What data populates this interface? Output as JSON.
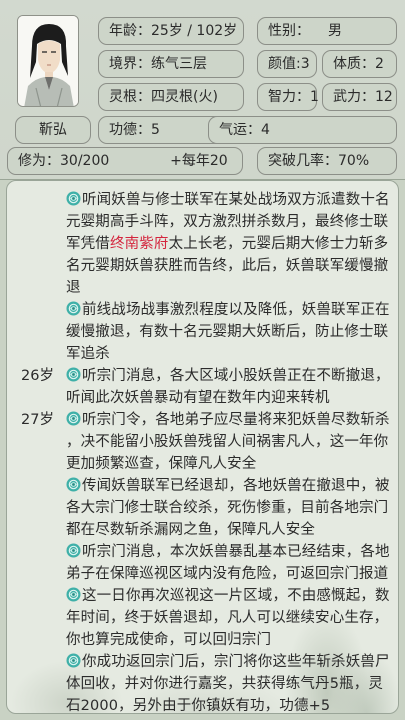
{
  "character": {
    "name": "靳弘",
    "age": "年龄：25岁 / 102岁",
    "gender_label": "性别：",
    "gender": "男",
    "realm": "境界：练气三层",
    "looks": "颜值:3",
    "physique": "体质：2",
    "spirit_root": "灵根：四灵根(火)",
    "intelligence": "智力：1",
    "force": "武力：12",
    "merit": "功德：5",
    "luck": "气运：4",
    "cultivation": "修为：30/200",
    "per_year": "+每年20",
    "breakthrough": "突破几率：70%"
  },
  "log": {
    "year_labels": [
      "26岁",
      "27岁"
    ],
    "entries": [
      {
        "lines": [
          "听闻妖兽与修士联军在某处战场双方派遣数十名",
          "元婴期高手斗阵，双方激烈拼杀数月，最终修士联"
        ],
        "line3_pre": "军凭借",
        "line3_highlight": "终南紫府",
        "line3_post": "太上长老，元婴后期大修士力斩多",
        "line4": "名元婴期妖兽获胜而告终，此后，妖兽联军缓慢撤",
        "line5": "退"
      },
      {
        "lines": [
          "前线战场战事激烈程度以及降低，妖兽联军正在",
          "缓慢撤退，有数十名元婴期大妖断后，防止修士联",
          "军追杀"
        ]
      },
      {
        "lines": [
          "听宗门消息，各大区域小股妖兽正在不断撤退，",
          "听闻此次妖兽暴动有望在数年内迎来转机"
        ]
      },
      {
        "lines": [
          "听宗门令，各地弟子应尽量将来犯妖兽尽数斩杀",
          "，决不能留小股妖兽残留人间祸害凡人，这一年你",
          "更加频繁巡查，保障凡人安全"
        ]
      },
      {
        "lines": [
          "传闻妖兽联军已经退却，各地妖兽在撤退中，被",
          "各大宗门修士联合绞杀，死伤惨重，目前各地宗门",
          "都在尽数斩杀漏网之鱼，保障凡人安全"
        ]
      },
      {
        "lines": [
          "听宗门消息，本次妖兽暴乱基本已经结束，各地",
          "弟子在保障巡视区域内没有危险，可返回宗门报道"
        ]
      },
      {
        "lines": [
          "这一日你再次巡视这一片区域，不由感慨起，数",
          "年时间，终于妖兽退却，凡人可以继续安心生存，",
          "你也算完成使命，可以回归宗门"
        ]
      },
      {
        "lines": [
          "你成功返回宗门后，宗门将你这些年斩杀妖兽尸",
          "体回收，并对你进行嘉奖，共获得练气丹5瓶，灵",
          "石2000，另外由于你镇妖有功，功德+5"
        ]
      }
    ]
  },
  "colors": {
    "highlight": "#d4263e",
    "panel_bg": "#e5eae1",
    "stat_bg": "#cdd5c9",
    "icon_teal": "#3fb0a8"
  },
  "icons": [
    "portrait-avatar",
    "spirit-orb-icon"
  ]
}
